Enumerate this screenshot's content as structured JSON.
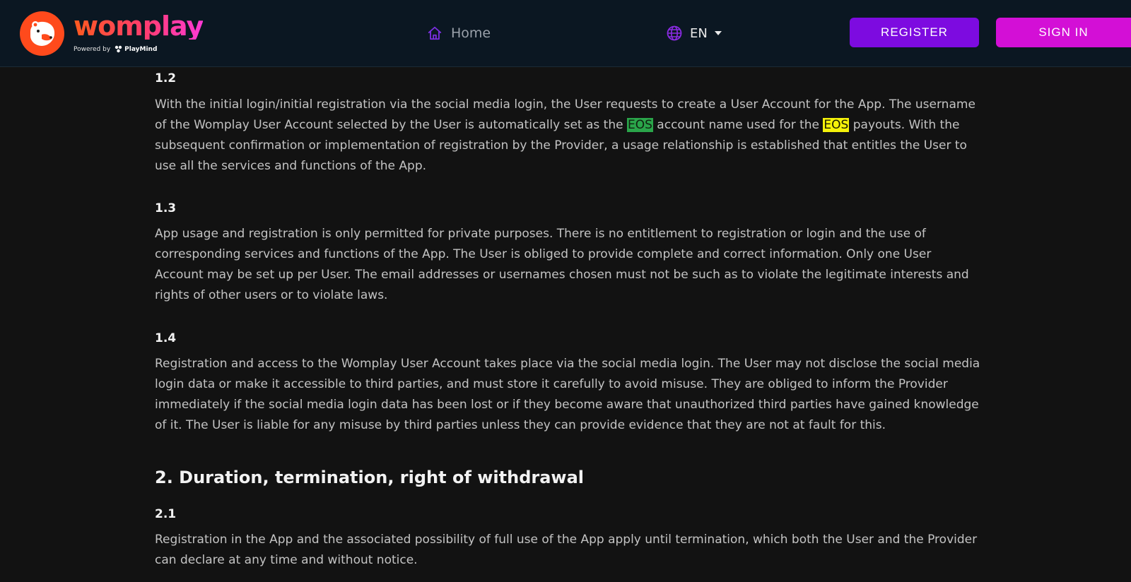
{
  "header": {
    "logo": {
      "wordmark": "womplay",
      "powered_by": "Powered by",
      "partner": "PlayMind",
      "icon": "bear-logo-icon"
    },
    "nav": {
      "home_label": "Home",
      "home_icon": "home-icon",
      "language_label": "EN",
      "language_icon": "globe-icon"
    },
    "buttons": {
      "register_label": "REGISTER",
      "signin_label": "SIGN IN"
    },
    "colors": {
      "bar": "#0b1722",
      "register": "#7d0be0",
      "signin": "#d30fd6",
      "accent_icon": "#8a2be2"
    }
  },
  "content": {
    "s1_2": {
      "heading": "1.2",
      "text_a": "With the initial login/initial registration via the social media login, the User requests to create a User Account for the App. The username of the Womplay User Account selected by the User is automatically set as the ",
      "hl1": "EOS",
      "text_b": " account name used for the ",
      "hl2": "EOS",
      "text_c": " payouts. With the subsequent confirmation or implementation of registration by the Provider, a usage relationship is established that entitles the User to use all the services and functions of the App."
    },
    "s1_3": {
      "heading": "1.3",
      "text": "App usage and registration is only permitted for private purposes. There is no entitlement to registration or login and the use of corresponding services and functions of the App. The User is obliged to provide complete and correct information. Only one User Account may be set up per User. The email addresses or usernames chosen must not be such as to violate the legitimate interests and rights of other users or to violate laws."
    },
    "s1_4": {
      "heading": "1.4",
      "text": "Registration and access to the Womplay User Account takes place via the social media login. The User may not disclose the social media login data or make it accessible to third parties, and must store it carefully to avoid misuse. They are obliged to inform the Provider immediately if the social media login data has been lost or if they become aware that unauthorized third parties have gained knowledge of it. The User is liable for any misuse by third parties unless they can provide evidence that they are not at fault for this."
    },
    "s2": {
      "heading": "2. Duration, termination, right of withdrawal"
    },
    "s2_1": {
      "heading": "2.1",
      "text": "Registration in the App and the associated possibility of full use of the App apply until termination, which both the User and the Provider can declare at any time and without notice."
    }
  }
}
